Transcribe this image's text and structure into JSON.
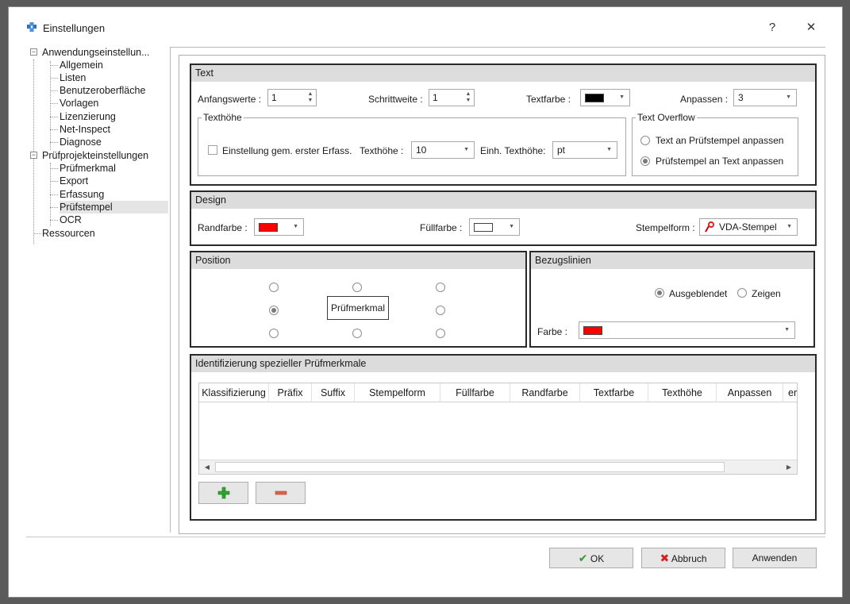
{
  "window": {
    "title": "Einstellungen",
    "help": "?",
    "close": "✕"
  },
  "tree": {
    "root1": "Anwendungseinstellun...",
    "app_items": [
      "Allgemein",
      "Listen",
      "Benutzeroberfläche",
      "Vorlagen",
      "Lizenzierung",
      "Net-Inspect",
      "Diagnose"
    ],
    "root2": "Prüfprojekteinstellungen",
    "project_items": [
      "Prüfmerkmal",
      "Export",
      "Erfassung",
      "Prüfstempel",
      "OCR"
    ],
    "root3": "Ressourcen",
    "selected": "Prüfstempel"
  },
  "text_group": {
    "title": "Text",
    "anfangswerte_label": "Anfangswerte :",
    "anfangswerte_value": "1",
    "schrittweite_label": "Schrittweite :",
    "schrittweite_value": "1",
    "textfarbe_label": "Textfarbe :",
    "textfarbe_color": "#000000",
    "anpassen_label": "Anpassen :",
    "anpassen_value": "3",
    "texthoehe_legend": "Texthöhe",
    "einstellung_label": "Einstellung gem. erster Erfass.",
    "texthoehe_label": "Texthöhe :",
    "texthoehe_value": "10",
    "einheit_label": "Einh. Texthöhe:",
    "einheit_value": "pt",
    "overflow_legend": "Text Overflow",
    "overflow_opt1": "Text an Prüfstempel anpassen",
    "overflow_opt2": "Prüfstempel an Text anpassen"
  },
  "design_group": {
    "title": "Design",
    "randfarbe_label": "Randfarbe :",
    "randfarbe_color": "#ff0000",
    "fuellfarbe_label": "Füllfarbe :",
    "fuellfarbe_color": "#ffffff",
    "stempelform_label": "Stempelform :",
    "stempelform_value": "VDA-Stempel"
  },
  "position_group": {
    "title": "Position",
    "center_label": "Prüfmerkmal"
  },
  "bezug_group": {
    "title": "Bezugslinien",
    "opt1": "Ausgeblendet",
    "opt2": "Zeigen",
    "farbe_label": "Farbe :",
    "farbe_color": "#ff0000"
  },
  "ident_group": {
    "title": "Identifizierung spezieller Prüfmerkmale",
    "columns": [
      "Klassifizierung",
      "Präfix",
      "Suffix",
      "Stempelform",
      "Füllfarbe",
      "Randfarbe",
      "Textfarbe",
      "Texthöhe",
      "Anpassen",
      "er"
    ]
  },
  "footer": {
    "ok": "OK",
    "abbruch": "Abbruch",
    "anwenden": "Anwenden"
  }
}
